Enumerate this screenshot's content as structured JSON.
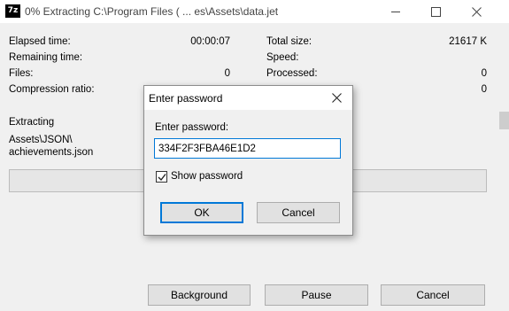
{
  "window": {
    "title": "0% Extracting C:\\Program Files ( ... es\\Assets\\data.jet",
    "app_icon_text": "7z"
  },
  "stats": {
    "elapsed_time_label": "Elapsed time:",
    "elapsed_time_value": "00:00:07",
    "remaining_time_label": "Remaining time:",
    "remaining_time_value": "",
    "files_label": "Files:",
    "files_value": "0",
    "compression_ratio_label": "Compression ratio:",
    "compression_ratio_value": "",
    "total_size_label": "Total size:",
    "total_size_value": "21617 K",
    "speed_label": "Speed:",
    "speed_value": "",
    "processed_label": "Processed:",
    "processed_value": "0",
    "packed_size_value": "0"
  },
  "extracting": {
    "label": "Extracting",
    "path_line1": "Assets\\JSON\\",
    "path_line2": "achievements.json",
    "progress_percent": 0
  },
  "buttons": {
    "background": "Background",
    "pause": "Pause",
    "cancel": "Cancel"
  },
  "dialog": {
    "title": "Enter password",
    "field_label": "Enter password:",
    "password_value": "334F2F3FBA46E1D2",
    "show_password_label": "Show password",
    "show_password_checked": true,
    "ok_label": "OK",
    "cancel_label": "Cancel"
  },
  "colors": {
    "accent": "#0078d7",
    "window_bg": "#f0f0f0",
    "titlebar_bg": "#ffffff"
  }
}
